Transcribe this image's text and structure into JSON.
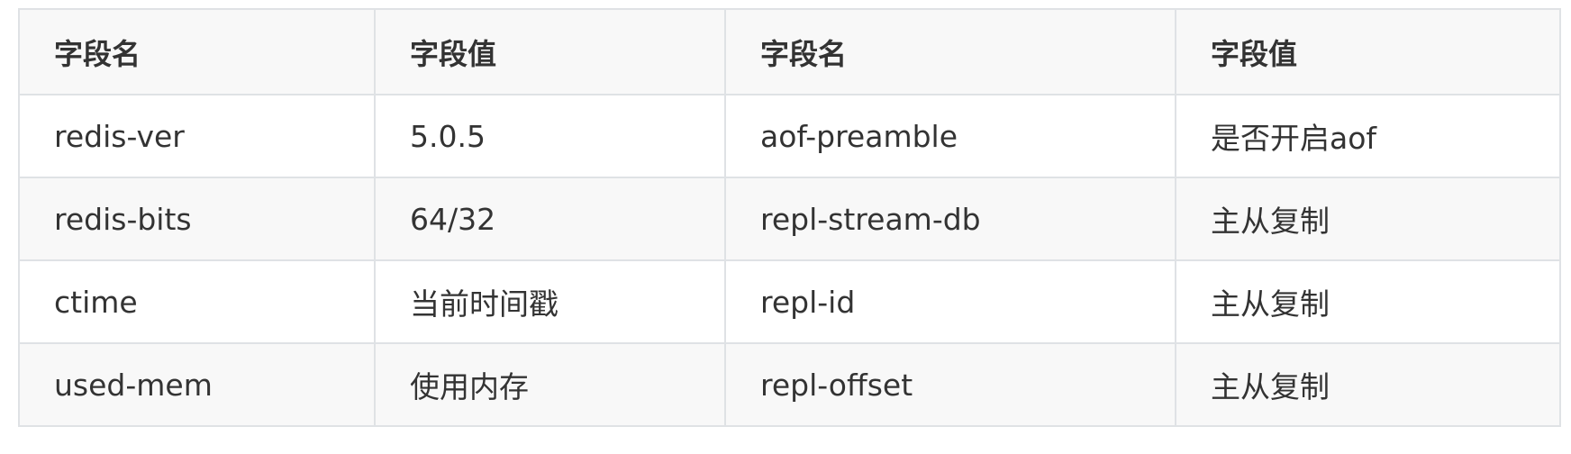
{
  "table": {
    "headers": [
      "字段名",
      "字段值",
      "字段名",
      "字段值"
    ],
    "rows": [
      [
        "redis-ver",
        "5.0.5",
        "aof-preamble",
        "是否开启aof"
      ],
      [
        "redis-bits",
        "64/32",
        "repl-stream-db",
        "主从复制"
      ],
      [
        "ctime",
        "当前时间戳",
        "repl-id",
        "主从复制"
      ],
      [
        "used-mem",
        "使用内存",
        "repl-offset",
        "主从复制"
      ]
    ]
  }
}
